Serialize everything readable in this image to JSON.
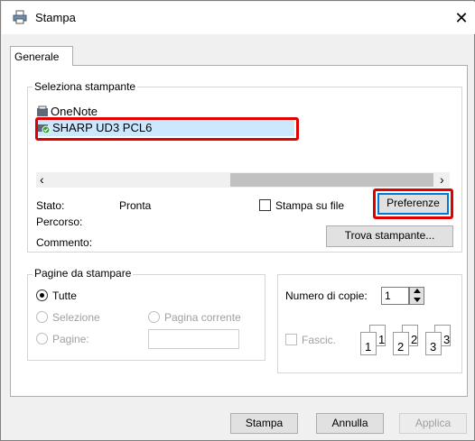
{
  "window": {
    "title": "Stampa",
    "close_label": "✕"
  },
  "tabs": [
    {
      "label": "Generale"
    }
  ],
  "printer_group": {
    "title": "Seleziona stampante",
    "printers": [
      {
        "name": "OneNote",
        "icon": "printer-icon"
      },
      {
        "name": "SHARP UD3 PCL6",
        "icon": "printer-default-icon",
        "selected": true
      }
    ],
    "scroll_left": "‹",
    "scroll_right": "›",
    "status_label": "Stato:",
    "status_value": "Pronta",
    "path_label": "Percorso:",
    "comment_label": "Commento:",
    "print_to_file_label": "Stampa su file",
    "preferences_button": "Preferenze",
    "find_printer_button": "Trova stampante..."
  },
  "pages_group": {
    "title": "Pagine da stampare",
    "all_label": "Tutte",
    "selection_label": "Selezione",
    "current_page_label": "Pagina corrente",
    "pages_label": "Pagine:"
  },
  "copies_group": {
    "copies_label": "Numero di copie:",
    "copies_value": "1",
    "collate_label": "Fascic.",
    "collate_pages": [
      [
        "1",
        "1"
      ],
      [
        "2",
        "2"
      ],
      [
        "3",
        "3"
      ]
    ]
  },
  "footer": {
    "print_button": "Stampa",
    "cancel_button": "Annulla",
    "apply_button": "Applica"
  },
  "colors": {
    "highlight": "#e00000",
    "selection": "#cce8ff",
    "accent": "#0078d7"
  }
}
